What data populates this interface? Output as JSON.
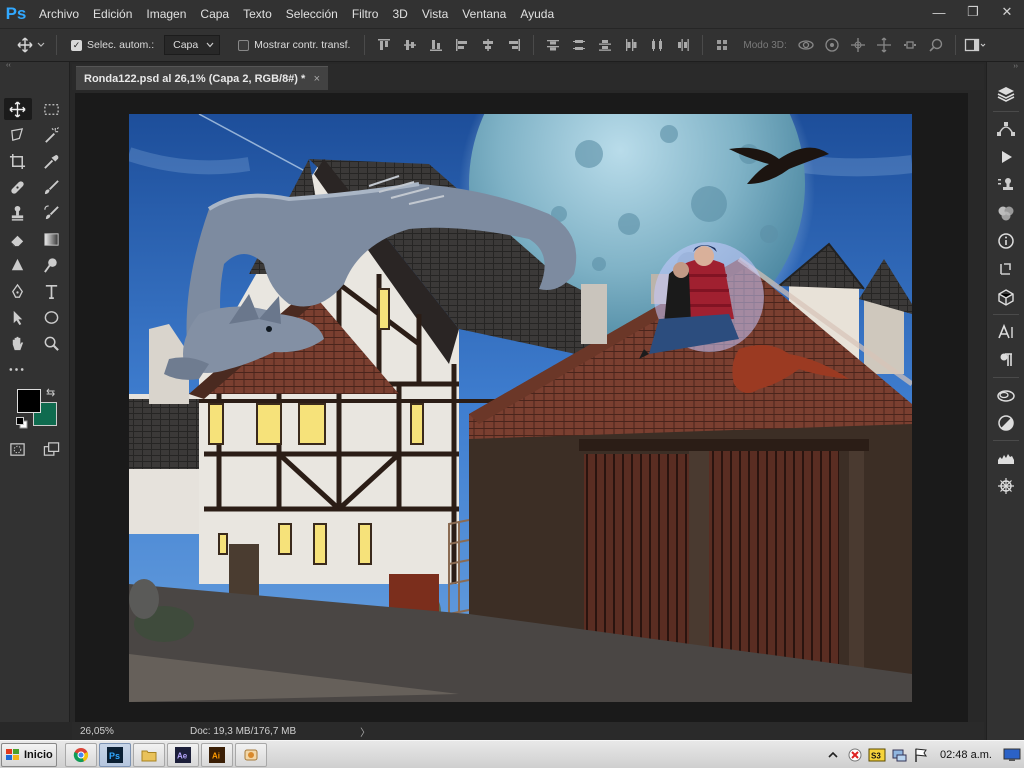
{
  "app": {
    "logo": "Ps"
  },
  "menu": [
    "Archivo",
    "Edición",
    "Imagen",
    "Capa",
    "Texto",
    "Selección",
    "Filtro",
    "3D",
    "Vista",
    "Ventana",
    "Ayuda"
  ],
  "window_controls": {
    "minimize": "—",
    "restore": "❐",
    "close": "✕"
  },
  "options": {
    "auto_select_checked": true,
    "auto_select_label": "Selec. autom.:",
    "auto_select_target": "Capa",
    "show_transform_checked": false,
    "show_transform_label": "Mostrar contr. transf.",
    "mode_3d_label": "Modo 3D:"
  },
  "document": {
    "tab_title": "Ronda122.psd al 26,1% (Capa 2, RGB/8#) *",
    "tab_close": "×",
    "zoom": "26,05%",
    "doc_info": "Doc: 19,3 MB/176,7 MB",
    "status_arrow": "〉"
  },
  "colors": {
    "foreground": "#000000",
    "background": "#0f6b4f",
    "accent": "#31a8ff"
  },
  "taskbar": {
    "start_label": "Inicio",
    "clock": "02:48 a.m."
  }
}
